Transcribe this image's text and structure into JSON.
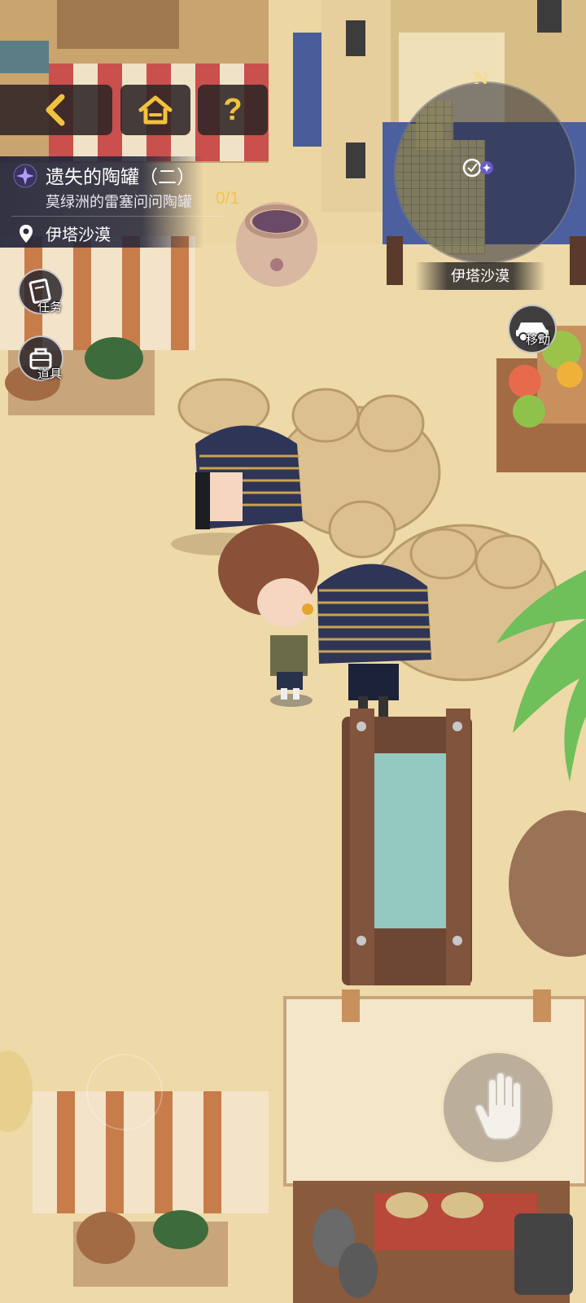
{
  "nav": {
    "back_icon": "chevron-left-icon",
    "home_icon": "home-icon",
    "help_label": "?"
  },
  "quest": {
    "title": "遗失的陶罐（二）",
    "description": "莫绿洲的雷塞问问陶罐",
    "progress": "0/1",
    "location": "伊塔沙漠",
    "quest_icon": "sparkle-star-icon",
    "location_icon": "map-pin-icon"
  },
  "side_buttons": {
    "tasks_label": "任务",
    "items_label": "道具"
  },
  "minimap": {
    "compass": "N",
    "area_name": "伊塔沙漠"
  },
  "move": {
    "label": "移动"
  },
  "interact": {
    "icon": "hand-icon"
  },
  "colors": {
    "accent_gold": "#f1c23d",
    "panel_bg": "#22243a",
    "sand": "#ecd6a4"
  }
}
